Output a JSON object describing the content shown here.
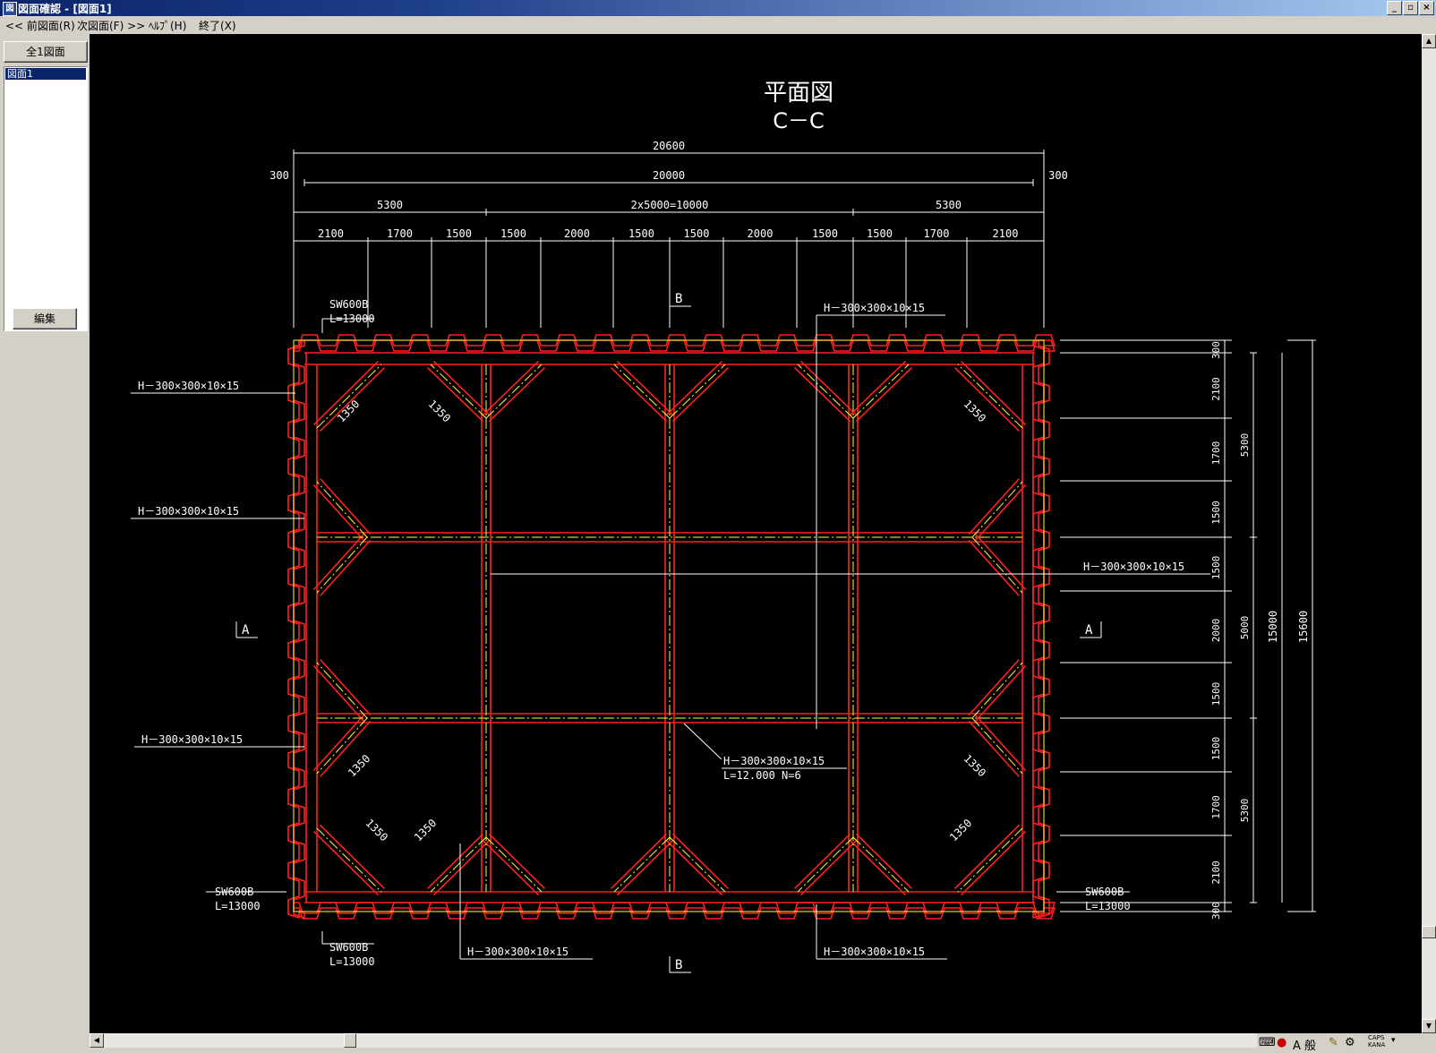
{
  "window": {
    "title": "図面確認 - [図面1]",
    "controls": [
      "_",
      "▫",
      "×"
    ]
  },
  "menu": {
    "items": [
      "<< 前図面(R)",
      "次図面(F) >>",
      "ﾍﾙﾌﾟ(H)",
      "終了(X)"
    ]
  },
  "sidebar": {
    "all_drawings_button": "全1図面",
    "list_items": [
      "図面1"
    ],
    "edit_button": "編集"
  },
  "drawing": {
    "title": "平面図",
    "subtitle": "C－C",
    "dims_top": {
      "overall": "20600",
      "inner": "20000",
      "side_left": "300",
      "side_right": "300",
      "row3": [
        "5300",
        "2x5000=10000",
        "5300"
      ],
      "row4": [
        "2100",
        "1700",
        "1500",
        "1500",
        "2000",
        "1500",
        "1500",
        "2000",
        "1500",
        "1500",
        "1700",
        "2100"
      ]
    },
    "dims_right": {
      "small": [
        "300",
        "2100",
        "1700",
        "1500",
        "1500",
        "2000",
        "1500",
        "1500",
        "1700",
        "2100",
        "300"
      ],
      "mid": [
        "5300",
        "5000",
        "5300"
      ],
      "inner": "15000",
      "overall": "15600"
    },
    "diag_dim": "1350",
    "labels": {
      "h_beam": "H－300×300×10×15",
      "sw_name": "SW600B",
      "sw_len": "L=13000",
      "center_beam_len": "L=12.000  N=6",
      "section_a": "A",
      "section_b": "B"
    }
  },
  "statusbar": {
    "ime_mode": "A 般",
    "caps": "CAPS",
    "kana": "KANA"
  },
  "colors": {
    "beam": "#ff2020",
    "center_line": "#ffff40",
    "dimension": "#ffffff",
    "canvas_bg": "#000000"
  }
}
